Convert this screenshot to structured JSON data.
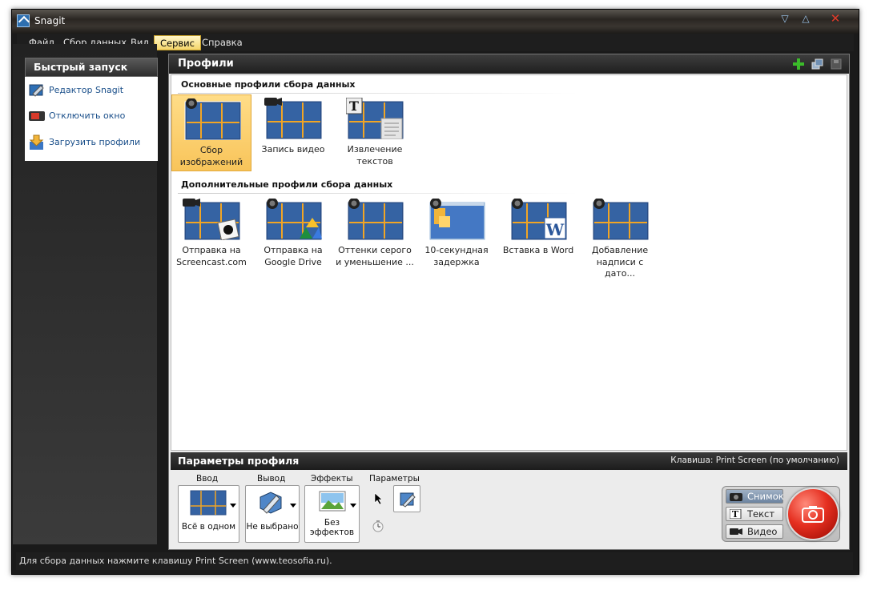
{
  "window": {
    "title": "Snagit"
  },
  "menu": [
    "Файл",
    "Сбор данных",
    "Вид",
    "Сервис",
    "Справка"
  ],
  "menu_active": "Сервис",
  "quick_start": {
    "header": "Быстрый запуск",
    "items": [
      {
        "label": "Редактор Snagit",
        "icon": "snagit-editor-icon"
      },
      {
        "label": "Отключить окно",
        "icon": "disable-window-icon"
      },
      {
        "label": "Загрузить профили",
        "icon": "load-profiles-icon"
      }
    ]
  },
  "profiles": {
    "header": "Профили",
    "basic_title": "Основные профили сбора данных",
    "basic": [
      {
        "line1": "Сбор",
        "line2": "изображений",
        "selected": true,
        "icon": "camera-icon"
      },
      {
        "line1": "Запись видео",
        "line2": "",
        "icon": "video-camera-icon"
      },
      {
        "line1": "Извлечение",
        "line2": "текстов",
        "icon": "text-icon"
      }
    ],
    "extra_title": "Дополнительные профили сбора данных",
    "extra": [
      {
        "line1": "Отправка на",
        "line2": "Screencast.com",
        "icon": "screencast-icon"
      },
      {
        "line1": "Отправка на",
        "line2": "Google Drive",
        "icon": "google-drive-icon"
      },
      {
        "line1": "Оттенки серого",
        "line2": "и уменьшение ...",
        "icon": "grayscale-icon"
      },
      {
        "line1": "10-секундная",
        "line2": "задержка",
        "icon": "timer-icon"
      },
      {
        "line1": "Вставка в Word",
        "line2": "",
        "icon": "word-icon"
      },
      {
        "line1": "Добавление",
        "line2": "надписи с дато...",
        "icon": "caption-icon"
      }
    ]
  },
  "params": {
    "header": "Параметры профиля",
    "hint": "Клавиша: Print Screen (по умолчанию)",
    "input_label": "Ввод",
    "input_value": "Всё в одном",
    "output_label": "Вывод",
    "output_value": "Не выбрано",
    "effects_label": "Эффекты",
    "effects_value1": "Без",
    "effects_value2": "эффектов",
    "options_label": "Параметры"
  },
  "capture": {
    "modes": [
      "Снимок",
      "Текст",
      "Видео"
    ],
    "active_mode": "Снимок"
  },
  "status": "Для сбора данных нажмите клавишу  Print Screen  (www.teosofia.ru).",
  "colors": {
    "accent": "#f4d56a",
    "capture_red": "#e52f20",
    "link": "#1a4f8a"
  }
}
